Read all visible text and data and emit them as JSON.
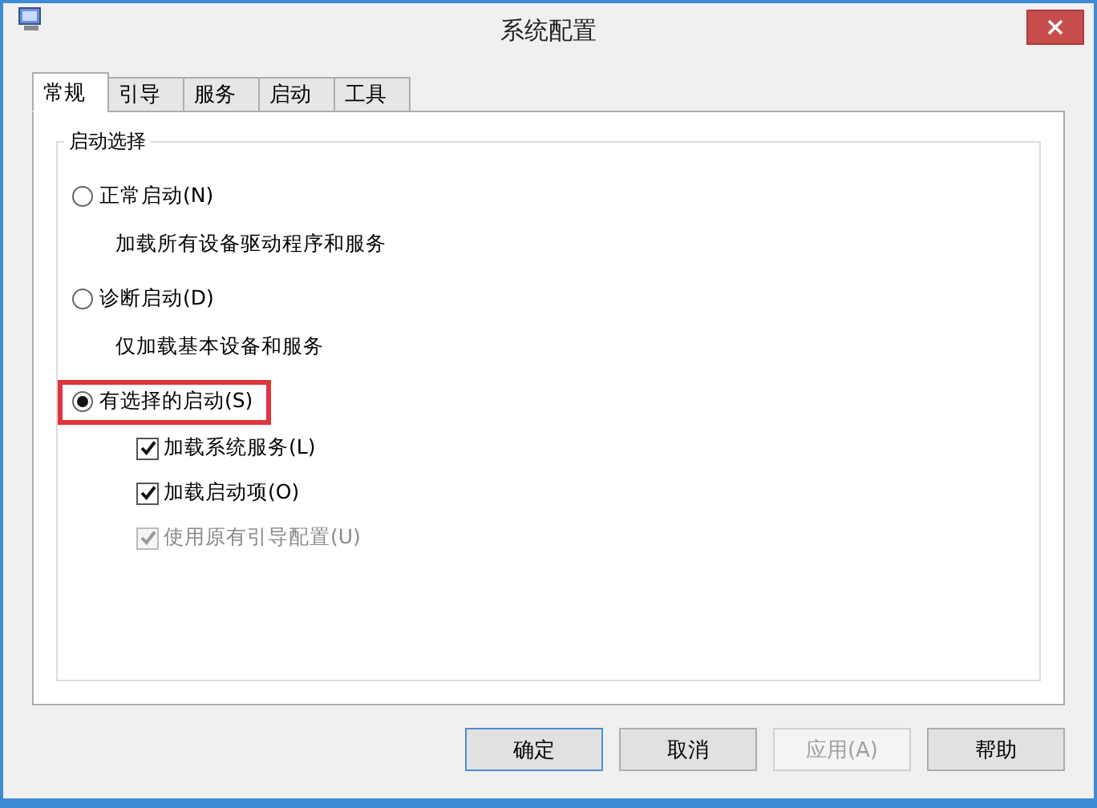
{
  "window": {
    "title": "系统配置"
  },
  "tabs": [
    {
      "label": "常规",
      "selected": true
    },
    {
      "label": "引导",
      "selected": false
    },
    {
      "label": "服务",
      "selected": false
    },
    {
      "label": "启动",
      "selected": false
    },
    {
      "label": "工具",
      "selected": false
    }
  ],
  "group": {
    "title": "启动选择",
    "options": [
      {
        "label": "正常启动(N)",
        "description": "加载所有设备驱动程序和服务",
        "selected": false,
        "highlighted": false
      },
      {
        "label": "诊断启动(D)",
        "description": "仅加载基本设备和服务",
        "selected": false,
        "highlighted": false
      },
      {
        "label": "有选择的启动(S)",
        "selected": true,
        "highlighted": true,
        "checkboxes": [
          {
            "label": "加载系统服务(L)",
            "checked": true,
            "disabled": false
          },
          {
            "label": "加载启动项(O)",
            "checked": true,
            "disabled": false
          },
          {
            "label": "使用原有引导配置(U)",
            "checked": true,
            "disabled": true
          }
        ]
      }
    ]
  },
  "buttons": [
    {
      "label": "确定",
      "disabled": false,
      "default": true
    },
    {
      "label": "取消",
      "disabled": false,
      "default": false
    },
    {
      "label": "应用(A)",
      "disabled": true,
      "default": false
    },
    {
      "label": "帮助",
      "disabled": false,
      "default": false
    }
  ]
}
